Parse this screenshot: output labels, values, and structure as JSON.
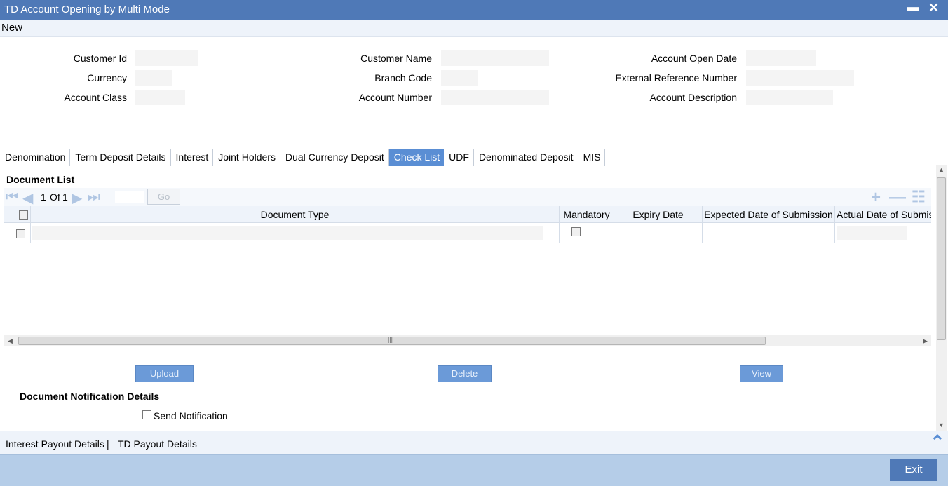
{
  "window": {
    "title": "TD Account Opening by Multi Mode",
    "minimize_glyph": "▬",
    "close_glyph": "✕"
  },
  "menu": {
    "new_label": "New"
  },
  "form": {
    "customer_id": {
      "label": "Customer Id",
      "value": ""
    },
    "currency": {
      "label": "Currency",
      "value": ""
    },
    "account_class": {
      "label": "Account Class",
      "value": ""
    },
    "customer_name": {
      "label": "Customer Name",
      "value": ""
    },
    "branch_code": {
      "label": "Branch Code",
      "value": ""
    },
    "account_number": {
      "label": "Account Number",
      "value": ""
    },
    "account_open_date": {
      "label": "Account Open Date",
      "value": ""
    },
    "external_reference_number": {
      "label": "External Reference Number",
      "value": ""
    },
    "account_description": {
      "label": "Account Description",
      "value": ""
    }
  },
  "tabs": [
    {
      "label": "Denomination",
      "active": false
    },
    {
      "label": "Term Deposit Details",
      "active": false
    },
    {
      "label": "Interest",
      "active": false
    },
    {
      "label": "Joint Holders",
      "active": false
    },
    {
      "label": "Dual Currency Deposit",
      "active": false
    },
    {
      "label": "Check List",
      "active": true
    },
    {
      "label": "UDF",
      "active": false
    },
    {
      "label": "Denominated Deposit",
      "active": false
    },
    {
      "label": "MIS",
      "active": false
    }
  ],
  "document_list": {
    "title": "Document List",
    "pagination": {
      "current": "1",
      "of_label": "Of",
      "total": "1",
      "go_label": "Go"
    },
    "columns": [
      "Document Type",
      "Mandatory",
      "Expiry Date",
      "Expected Date of Submission",
      "Actual Date of Submission"
    ],
    "rows": [
      {
        "document_type": "",
        "mandatory": false,
        "expiry_date": "",
        "expected_date": "",
        "actual_date": ""
      }
    ]
  },
  "buttons": {
    "upload": "Upload",
    "delete": "Delete",
    "view": "View"
  },
  "notification": {
    "title": "Document Notification Details",
    "send_label": "Send Notification",
    "send_checked": false
  },
  "footer_links": {
    "interest_payout": "Interest Payout Details",
    "separator": "|",
    "td_payout": "TD Payout Details"
  },
  "bottom": {
    "exit_label": "Exit"
  },
  "icons": {
    "first": "first-page-icon",
    "prev": "prev-page-icon",
    "next": "next-page-icon",
    "last": "last-page-icon",
    "add": "add-row-icon",
    "remove": "delete-row-icon",
    "single": "single-view-icon",
    "top": "scroll-top-icon"
  },
  "colors": {
    "titlebar": "#4f79b7",
    "active_tab": "#5a8ed4",
    "button": "#6b9ad8",
    "bottom_bar": "#b5cde8"
  }
}
